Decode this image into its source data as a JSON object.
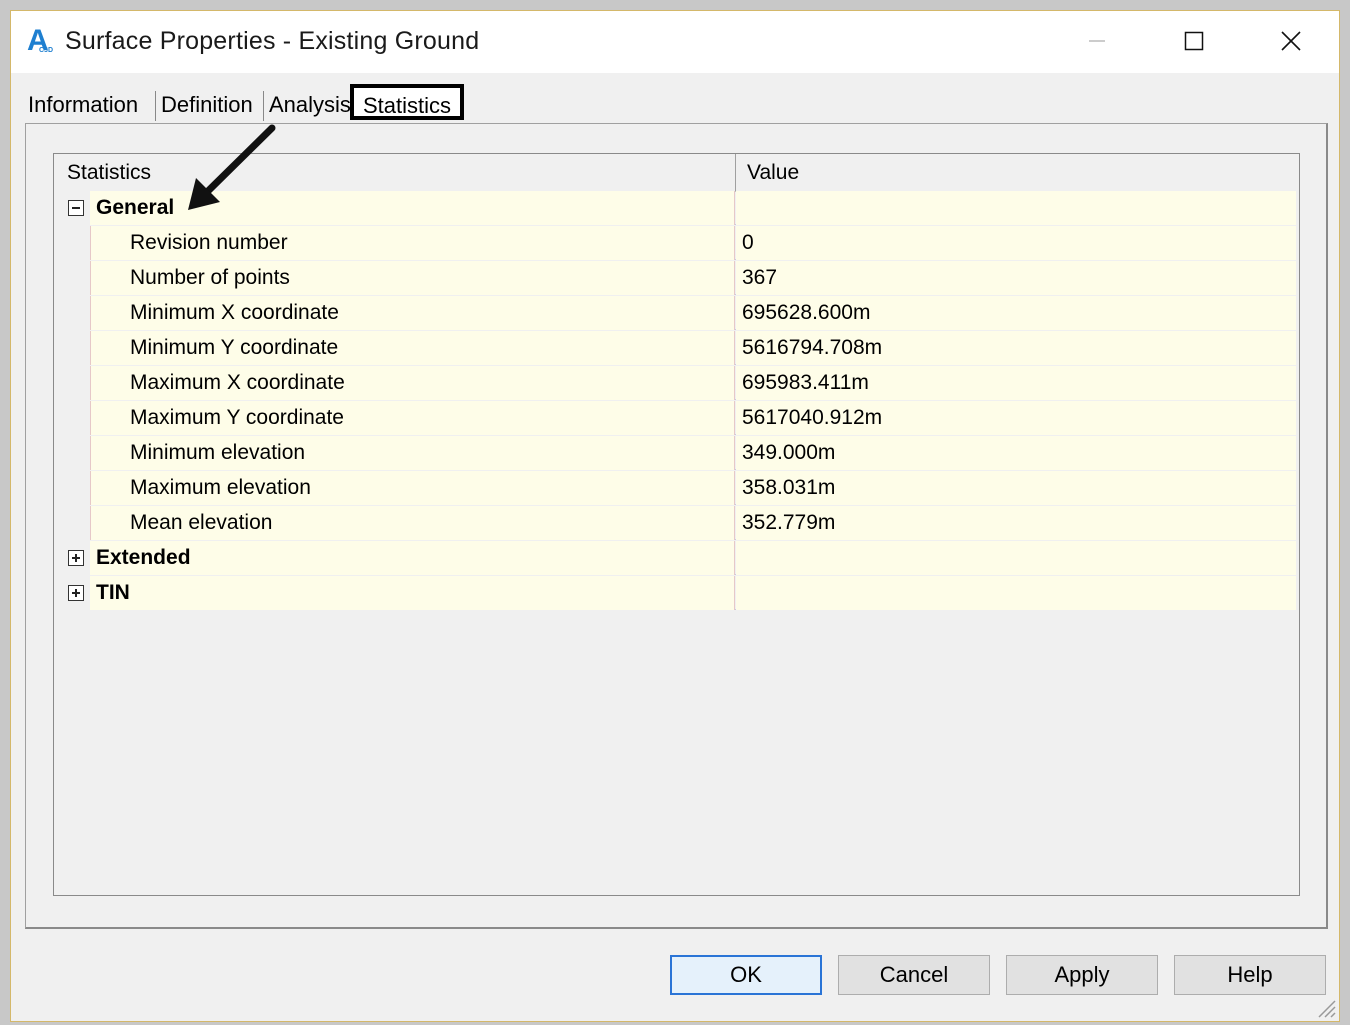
{
  "window": {
    "title": "Surface Properties - Existing Ground",
    "app_icon": "civil3d-logo-icon",
    "app_icon_letter": "A",
    "app_icon_sub": "C3D"
  },
  "tabs": [
    {
      "label": "Information",
      "active": false
    },
    {
      "label": "Definition",
      "active": false
    },
    {
      "label": "Analysis",
      "active": false
    },
    {
      "label": "Statistics",
      "active": true
    }
  ],
  "grid": {
    "col_statistics": "Statistics",
    "col_value": "Value",
    "groups": [
      {
        "label": "General",
        "expanded": true,
        "rows": [
          {
            "label": "Revision number",
            "value": "0"
          },
          {
            "label": "Number of points",
            "value": "367"
          },
          {
            "label": "Minimum X coordinate",
            "value": "695628.600m"
          },
          {
            "label": "Minimum Y coordinate",
            "value": "5616794.708m"
          },
          {
            "label": "Maximum X coordinate",
            "value": "695983.411m"
          },
          {
            "label": "Maximum Y coordinate",
            "value": "5617040.912m"
          },
          {
            "label": "Minimum elevation",
            "value": "349.000m"
          },
          {
            "label": "Maximum elevation",
            "value": "358.031m"
          },
          {
            "label": "Mean elevation",
            "value": "352.779m"
          }
        ]
      },
      {
        "label": "Extended",
        "expanded": false
      },
      {
        "label": "TIN",
        "expanded": false
      }
    ]
  },
  "buttons": {
    "ok": "OK",
    "cancel": "Cancel",
    "apply": "Apply",
    "help": "Help"
  },
  "colors": {
    "accent": "#2a74d6",
    "row_background": "#fefde8",
    "icon_blue": "#1e7fd0"
  }
}
